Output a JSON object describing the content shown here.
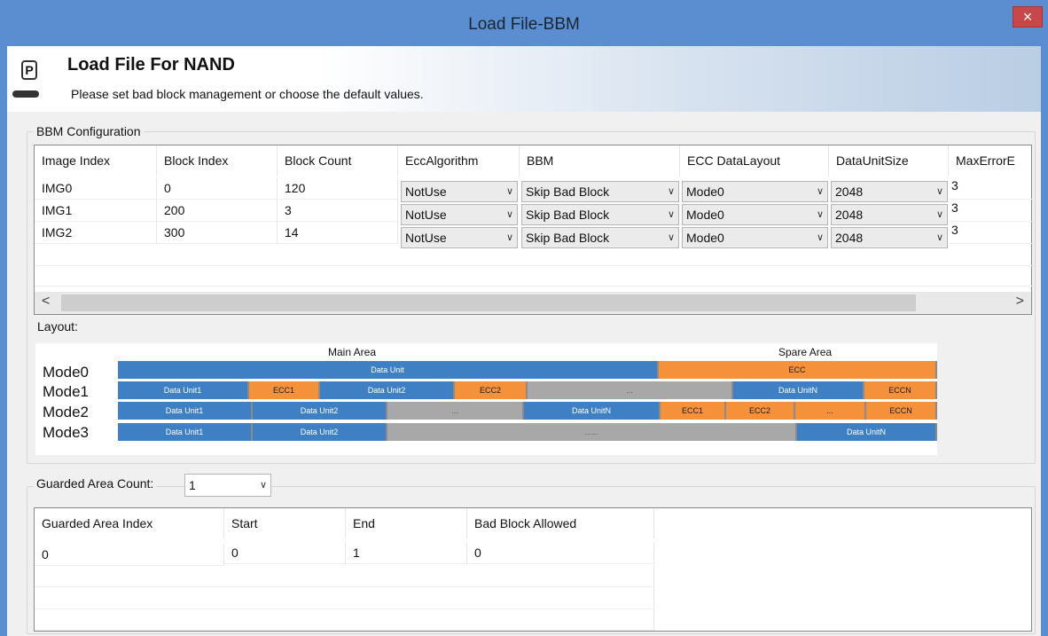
{
  "window": {
    "title": "Load File-BBM",
    "close_label": "×"
  },
  "header": {
    "title": "Load File For NAND",
    "subtitle": "Please set bad block management or choose the default values.",
    "logo_text": "P"
  },
  "bbm": {
    "legend": "BBM Configuration",
    "columns": [
      "Image Index",
      "Block Index",
      "Block Count",
      "EccAlgorithm",
      "BBM",
      "ECC DataLayout",
      "DataUnitSize",
      "MaxErrorE"
    ],
    "rows": [
      {
        "image": "IMG0",
        "block_index": "0",
        "block_count": "120",
        "ecc": "NotUse",
        "bbm": "Skip Bad Block",
        "layout": "Mode0",
        "unit_size": "2048",
        "max_error": "3"
      },
      {
        "image": "IMG1",
        "block_index": "200",
        "block_count": "3",
        "ecc": "NotUse",
        "bbm": "Skip Bad Block",
        "layout": "Mode0",
        "unit_size": "2048",
        "max_error": "3"
      },
      {
        "image": "IMG2",
        "block_index": "300",
        "block_count": "14",
        "ecc": "NotUse",
        "bbm": "Skip Bad Block",
        "layout": "Mode0",
        "unit_size": "2048",
        "max_error": "3"
      }
    ],
    "scroll_left": "<",
    "scroll_right": ">"
  },
  "layout": {
    "label": "Layout:",
    "main_area": "Main Area",
    "spare_area": "Spare Area",
    "modes": [
      "Mode0",
      "Mode1",
      "Mode2",
      "Mode3"
    ],
    "seg": {
      "data_unit": "Data Unit",
      "ecc": "ECC",
      "data_unit1": "Data Unit1",
      "data_unit2": "Data Unit2",
      "data_unitn": "Data UnitN",
      "ecc1": "ECC1",
      "ecc2": "ECC2",
      "eccn": "ECCN",
      "ellipsis": "...",
      "ellipsis_long": "......"
    },
    "colors": {
      "data": "#3f7fc3",
      "ecc": "#f5913b",
      "gap": "#a8a8a8"
    }
  },
  "guarded": {
    "count_label": "Guarded Area Count:",
    "count_value": "1",
    "columns": [
      "Guarded Area Index",
      "Start",
      "End",
      "Bad Block Allowed"
    ],
    "rows": [
      {
        "index": "0",
        "start": "0",
        "end": "1",
        "allowed": "0"
      }
    ]
  },
  "icons": {
    "close": "close-icon",
    "logo": "dediprog-logo-icon",
    "dropdown": "chevron-down-icon"
  }
}
